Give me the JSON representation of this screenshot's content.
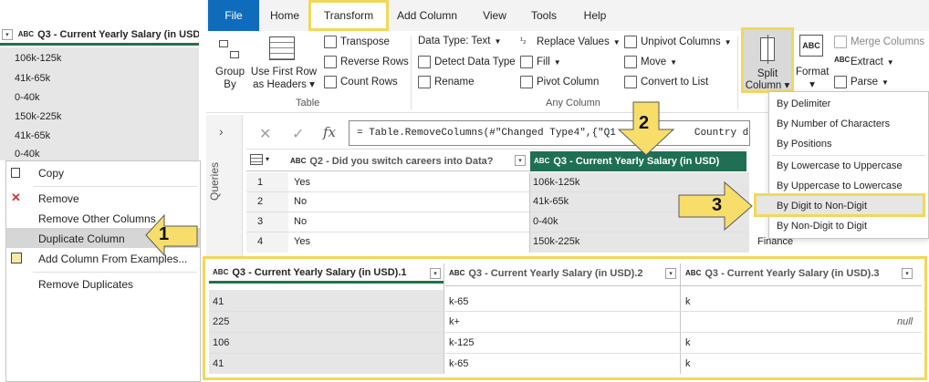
{
  "left_panel": {
    "header": "Q3 - Current Yearly Salary (in USD)",
    "rows": [
      "106k-125k",
      "41k-65k",
      "0-40k",
      "150k-225k",
      "41k-65k",
      "0-40k"
    ]
  },
  "context_menu": {
    "items": [
      "Copy",
      "Remove",
      "Remove Other Columns",
      "Duplicate Column",
      "Add Column From Examples...",
      "Remove Duplicates"
    ]
  },
  "ribbon": {
    "tabs": [
      "File",
      "Home",
      "Transform",
      "Add Column",
      "View",
      "Tools",
      "Help"
    ],
    "group_by": "Group By",
    "use_first_row": "Use First Row as Headers",
    "transpose": "Transpose",
    "reverse_rows": "Reverse Rows",
    "count_rows": "Count Rows",
    "table_group": "Table",
    "data_type": "Data Type: Text",
    "detect_data_type": "Detect Data Type",
    "rename": "Rename",
    "replace_values": "Replace Values",
    "fill": "Fill",
    "pivot_column": "Pivot Column",
    "unpivot_columns": "Unpivot Columns",
    "move": "Move",
    "convert_to_list": "Convert to List",
    "any_column_group": "Any Column",
    "split_column": "Split Column",
    "format": "Format",
    "merge_columns": "Merge Columns",
    "extract": "Extract",
    "parse": "Parse"
  },
  "queries_label": "Queries",
  "formula": "= Table.RemoveColumns(#\"Changed Type4\",{\"Q1",
  "formula_tail": "Country do",
  "main_grid": {
    "col1": "Q2 - Did you switch careers into Data?",
    "col2": "Q3 - Current Yearly Salary (in USD)",
    "rows": [
      {
        "n": "1",
        "a": "Yes",
        "b": "106k-125k"
      },
      {
        "n": "2",
        "a": "No",
        "b": "41k-65k"
      },
      {
        "n": "3",
        "a": "No",
        "b": "0-40k"
      },
      {
        "n": "4",
        "a": "Yes",
        "b": "150k-225k"
      }
    ],
    "extra": "Finance"
  },
  "split_menu": {
    "items": [
      "By Delimiter",
      "By Number of Characters",
      "By Positions",
      "By Lowercase to Uppercase",
      "By Uppercase to Lowercase",
      "By Digit to Non-Digit",
      "By Non-Digit to Digit"
    ]
  },
  "result_grid": {
    "cols": [
      "Q3 - Current Yearly Salary (in USD).1",
      "Q3 - Current Yearly Salary (in USD).2",
      "Q3 - Current Yearly Salary (in USD).3"
    ],
    "rows": [
      [
        "41",
        "k-65",
        "k"
      ],
      [
        "225",
        "k+",
        "null"
      ],
      [
        "106",
        "k-125",
        "k"
      ],
      [
        "41",
        "k-65",
        "k"
      ]
    ]
  },
  "callouts": [
    "1",
    "2",
    "3"
  ],
  "colors": {
    "accent": "#217346",
    "highlight": "#f2d85a",
    "file_tab": "#0f6cbd"
  }
}
